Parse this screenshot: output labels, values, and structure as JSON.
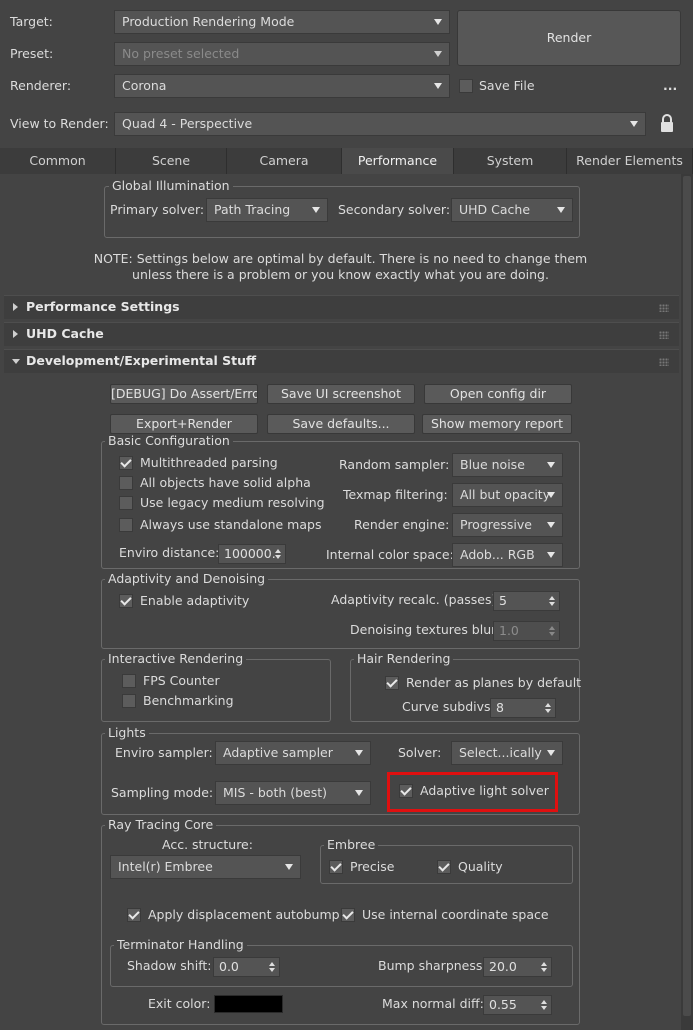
{
  "header": {
    "target_label": "Target:",
    "target_value": "Production Rendering Mode",
    "preset_label": "Preset:",
    "preset_value": "No preset selected",
    "renderer_label": "Renderer:",
    "renderer_value": "Corona",
    "save_file_label": "Save File",
    "ellipsis": "...",
    "view_label": "View to Render:",
    "view_value": "Quad 4 - Perspective",
    "render_button": "Render"
  },
  "tabs": [
    {
      "label": "Common"
    },
    {
      "label": "Scene"
    },
    {
      "label": "Camera"
    },
    {
      "label": "Performance"
    },
    {
      "label": "System"
    },
    {
      "label": "Render Elements"
    }
  ],
  "gi": {
    "title": "Global Illumination",
    "primary_label": "Primary solver:",
    "primary_value": "Path Tracing",
    "secondary_label": "Secondary solver:",
    "secondary_value": "UHD Cache"
  },
  "note": {
    "line1": "NOTE: Settings below are optimal by default. There is no need to change them",
    "line2": "unless there is a problem or you know exactly what you are doing."
  },
  "rollouts": {
    "perf": "Performance Settings",
    "uhd": "UHD Cache",
    "dev": "Development/Experimental Stuff"
  },
  "dev_buttons": {
    "debug": "[DEBUG] Do Assert/Error",
    "screenshot": "Save UI screenshot",
    "config": "Open config dir",
    "export": "Export+Render",
    "defaults": "Save defaults...",
    "memory": "Show memory report"
  },
  "basic": {
    "title": "Basic Configuration",
    "multithreaded": "Multithreaded parsing",
    "solid_alpha": "All objects have solid alpha",
    "legacy_medium": "Use legacy medium resolving",
    "standalone_maps": "Always use standalone maps",
    "enviro_distance_label": "Enviro distance:",
    "enviro_distance_value": "100000.",
    "random_sampler_label": "Random sampler:",
    "random_sampler_value": "Blue noise",
    "texmap_label": "Texmap filtering:",
    "texmap_value": "All but opacity",
    "engine_label": "Render engine:",
    "engine_value": "Progressive",
    "color_space_label": "Internal color space:",
    "color_space_value": "Adob... RGB"
  },
  "adaptivity": {
    "title": "Adaptivity and Denoising",
    "enable": "Enable adaptivity",
    "recalc_label": "Adaptivity recalc. (passes):",
    "recalc_value": "5",
    "blur_label": "Denoising textures blur:",
    "blur_value": "1.0"
  },
  "interactive": {
    "title": "Interactive Rendering",
    "fps": "FPS Counter",
    "bench": "Benchmarking"
  },
  "hair": {
    "title": "Hair Rendering",
    "planes": "Render as planes by default",
    "subdivs_label": "Curve subdivs:",
    "subdivs_value": "8"
  },
  "lights": {
    "title": "Lights",
    "enviro_label": "Enviro sampler:",
    "enviro_value": "Adaptive sampler",
    "solver_label": "Solver:",
    "solver_value": "Select...ically",
    "sampling_label": "Sampling mode:",
    "sampling_value": "MIS - both (best)",
    "adaptive_solver": "Adaptive light solver",
    "highlight_color": "#e01010"
  },
  "raytracing": {
    "title": "Ray Tracing Core",
    "acc_label": "Acc. structure:",
    "acc_value": "Intel(r) Embree",
    "embree_title": "Embree",
    "precise": "Precise",
    "quality": "Quality",
    "displacement": "Apply displacement autobump",
    "internal_coord": "Use internal coordinate space"
  },
  "terminator": {
    "title": "Terminator Handling",
    "shadow_label": "Shadow shift:",
    "shadow_value": "0.0",
    "bump_label": "Bump sharpness:",
    "bump_value": "20.0",
    "exit_label": "Exit color:",
    "exit_color": "#000000",
    "max_normal_label": "Max normal diff:",
    "max_normal_value": "0.55"
  }
}
